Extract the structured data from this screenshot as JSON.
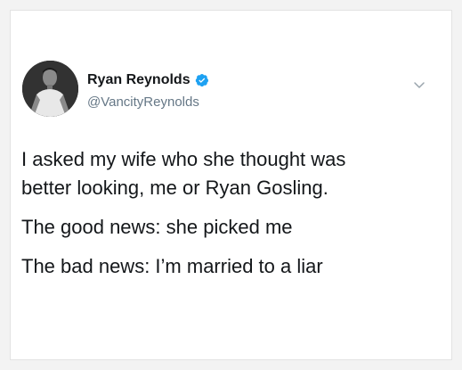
{
  "tweet": {
    "author_name": "Ryan Reynolds",
    "author_handle": "@VancityReynolds",
    "verified": true,
    "lines": [
      "I asked my wife who she thought was",
      "better looking, me or Ryan Gosling.",
      "The good news: she picked me",
      "The bad news: I’m married to a liar"
    ]
  },
  "icons": {
    "verified": "verified-badge-icon",
    "menu": "chevron-down-icon"
  },
  "colors": {
    "verified_blue": "#1da1f2",
    "text": "#14171a",
    "secondary_text": "#657786"
  }
}
